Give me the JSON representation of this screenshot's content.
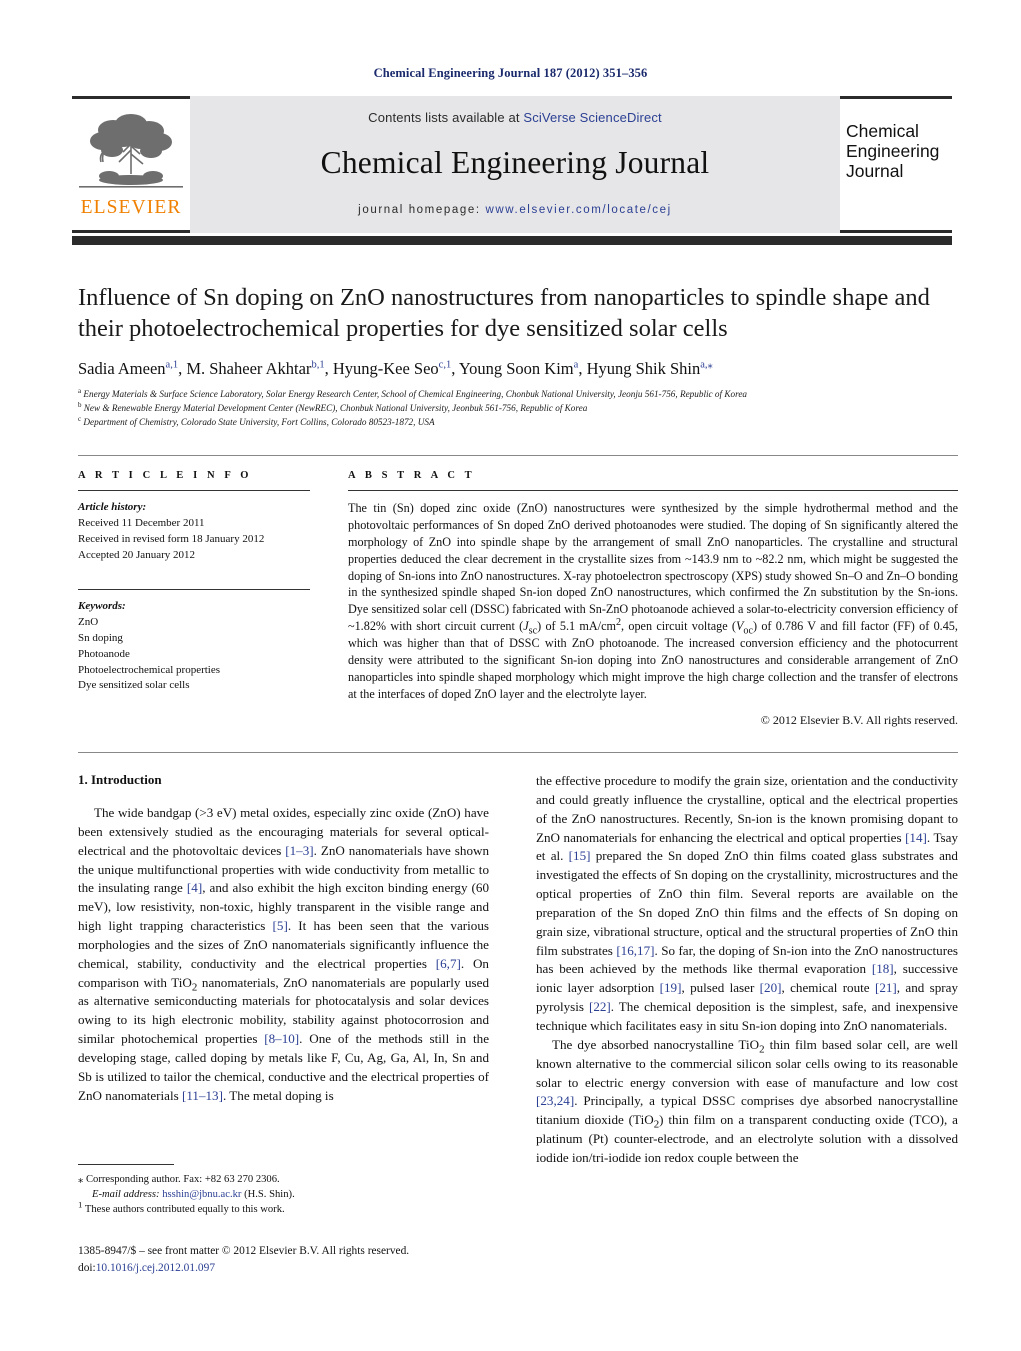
{
  "running_head": "Chemical Engineering Journal 187 (2012) 351–356",
  "masthead": {
    "publisher_logo_text": "ELSEVIER",
    "contents_prefix": "Contents lists available at ",
    "contents_link": "SciVerse ScienceDirect",
    "journal_title": "Chemical Engineering Journal",
    "homepage_prefix": "journal homepage: ",
    "homepage_url": "www.elsevier.com/locate/cej",
    "cover_line1": "Chemical",
    "cover_line2": "Engineering",
    "cover_line3": "Journal"
  },
  "article": {
    "title": "Influence of Sn doping on ZnO nanostructures from nanoparticles to spindle shape and their photoelectrochemical properties for dye sensitized solar cells",
    "authors_html": "Sadia Ameen<sup>a,1</sup>, M. Shaheer Akhtar<sup>b,1</sup>, Hyung-Kee Seo<sup>c,1</sup>, Young Soon Kim<sup>a</sup>, Hyung Shik Shin<sup>a,⁎</sup>",
    "affiliations": [
      "Energy Materials & Surface Science Laboratory, Solar Energy Research Center, School of Chemical Engineering, Chonbuk National University, Jeonju 561-756, Republic of Korea",
      "New & Renewable Energy Material Development Center (NewREC), Chonbuk National University, Jeonbuk 561-756, Republic of Korea",
      "Department of Chemistry, Colorado State University, Fort Collins, Colorado 80523-1872, USA"
    ],
    "affiliation_marks": [
      "a",
      "b",
      "c"
    ]
  },
  "info": {
    "heading": "A R T I C L E   I N F O",
    "history_label": "Article history:",
    "history": [
      "Received 11 December 2011",
      "Received in revised form 18 January 2012",
      "Accepted 20 January 2012"
    ],
    "keywords_label": "Keywords:",
    "keywords": [
      "ZnO",
      "Sn doping",
      "Photoanode",
      "Photoelectrochemical properties",
      "Dye sensitized solar cells"
    ]
  },
  "abstract": {
    "heading": "A B S T R A C T",
    "text": "The tin (Sn) doped zinc oxide (ZnO) nanostructures were synthesized by the simple hydrothermal method and the photovoltaic performances of Sn doped ZnO derived photoanodes were studied. The doping of Sn significantly altered the morphology of ZnO into spindle shape by the arrangement of small ZnO nanoparticles. The crystalline and structural properties deduced the clear decrement in the crystallite sizes from ~143.9 nm to ~82.2 nm, which might be suggested the doping of Sn-ions into ZnO nanostructures. X-ray photoelectron spectroscopy (XPS) study showed Sn–O and Zn–O bonding in the synthesized spindle shaped Sn-ion doped ZnO nanostructures, which confirmed the Zn substitution by the Sn-ions. Dye sensitized solar cell (DSSC) fabricated with Sn-ZnO photoanode achieved a solar-to-electricity conversion efficiency of ~1.82% with short circuit current (Jsc) of 5.1 mA/cm2, open circuit voltage (Voc) of 0.786 V and fill factor (FF) of 0.45, which was higher than that of DSSC with ZnO photoanode. The increased conversion efficiency and the photocurrent density were attributed to the significant Sn-ion doping into ZnO nanostructures and considerable arrangement of ZnO nanoparticles into spindle shaped morphology which might improve the high charge collection and the transfer of electrons at the interfaces of doped ZnO layer and the electrolyte layer.",
    "copyright": "© 2012 Elsevier B.V. All rights reserved."
  },
  "body": {
    "section_heading": "1.  Introduction",
    "left_paragraph": "The wide bandgap (>3 eV) metal oxides, especially zinc oxide (ZnO) have been extensively studied as the encouraging materials for several optical-electrical and the photovoltaic devices [1–3]. ZnO nanomaterials have shown the unique multifunctional properties with wide conductivity from metallic to the insulating range [4], and also exhibit the high exciton binding energy (60 meV), low resistivity, non-toxic, highly transparent in the visible range and high light trapping characteristics [5]. It has been seen that the various morphologies and the sizes of ZnO nanomaterials significantly influence the chemical, stability, conductivity and the electrical properties [6,7]. On comparison with TiO2 nanomaterials, ZnO nanomaterials are popularly used as alternative semiconducting materials for photocatalysis and solar devices owing to its high electronic mobility, stability against photocorrosion and similar photochemical properties [8–10]. One of the methods still in the developing stage, called doping by metals like F, Cu, Ag, Ga, Al, In, Sn and Sb is utilized to tailor the chemical, conductive and the electrical properties of ZnO nanomaterials [11–13]. The metal doping is",
    "right_paragraph_1": "the effective procedure to modify the grain size, orientation and the conductivity and could greatly influence the crystalline, optical and the electrical properties of the ZnO nanostructures. Recently, Sn-ion is the known promising dopant to ZnO nanomaterials for enhancing the electrical and optical properties [14]. Tsay et al. [15] prepared the Sn doped ZnO thin films coated glass substrates and investigated the effects of Sn doping on the crystallinity, microstructures and the optical properties of ZnO thin film. Several reports are available on the preparation of the Sn doped ZnO thin films and the effects of Sn doping on grain size, vibrational structure, optical and the structural properties of ZnO thin film substrates [16,17]. So far, the doping of Sn-ion into the ZnO nanostructures has been achieved by the methods like thermal evaporation [18], successive ionic layer adsorption [19], pulsed laser [20], chemical route [21], and spray pyrolysis [22]. The chemical deposition is the simplest, safe, and inexpensive technique which facilitates easy in situ Sn-ion doping into ZnO nanomaterials.",
    "right_paragraph_2": "The dye absorbed nanocrystalline TiO2 thin film based solar cell, are well known alternative to the commercial silicon solar cells owing to its reasonable solar to electric energy conversion with ease of manufacture and low cost [23,24]. Principally, a typical DSSC comprises dye absorbed nanocrystalline titanium dioxide (TiO2) thin film on a transparent conducting oxide (TCO), a platinum (Pt) counter-electrode, and an electrolyte solution with a dissolved iodide ion/tri-iodide ion redox couple between the"
  },
  "footnotes": {
    "corresponding_mark": "⁎",
    "corresponding": "Corresponding author. Fax: +82 63 270 2306.",
    "email_label": "E-mail address:",
    "email": "hsshin@jbnu.ac.kr",
    "email_suffix": "(H.S. Shin).",
    "equal_mark": "1",
    "equal_contrib": "These authors contributed equally to this work."
  },
  "imprint": {
    "line1": "1385-8947/$ – see front matter © 2012 Elsevier B.V. All rights reserved.",
    "doi_label": "doi:",
    "doi": "10.1016/j.cej.2012.01.097"
  },
  "colors": {
    "link": "#2b3f93",
    "elsevier_orange": "#f08000",
    "rule_dark": "#2b2b2b",
    "masthead_grey": "#e6e6e8"
  }
}
